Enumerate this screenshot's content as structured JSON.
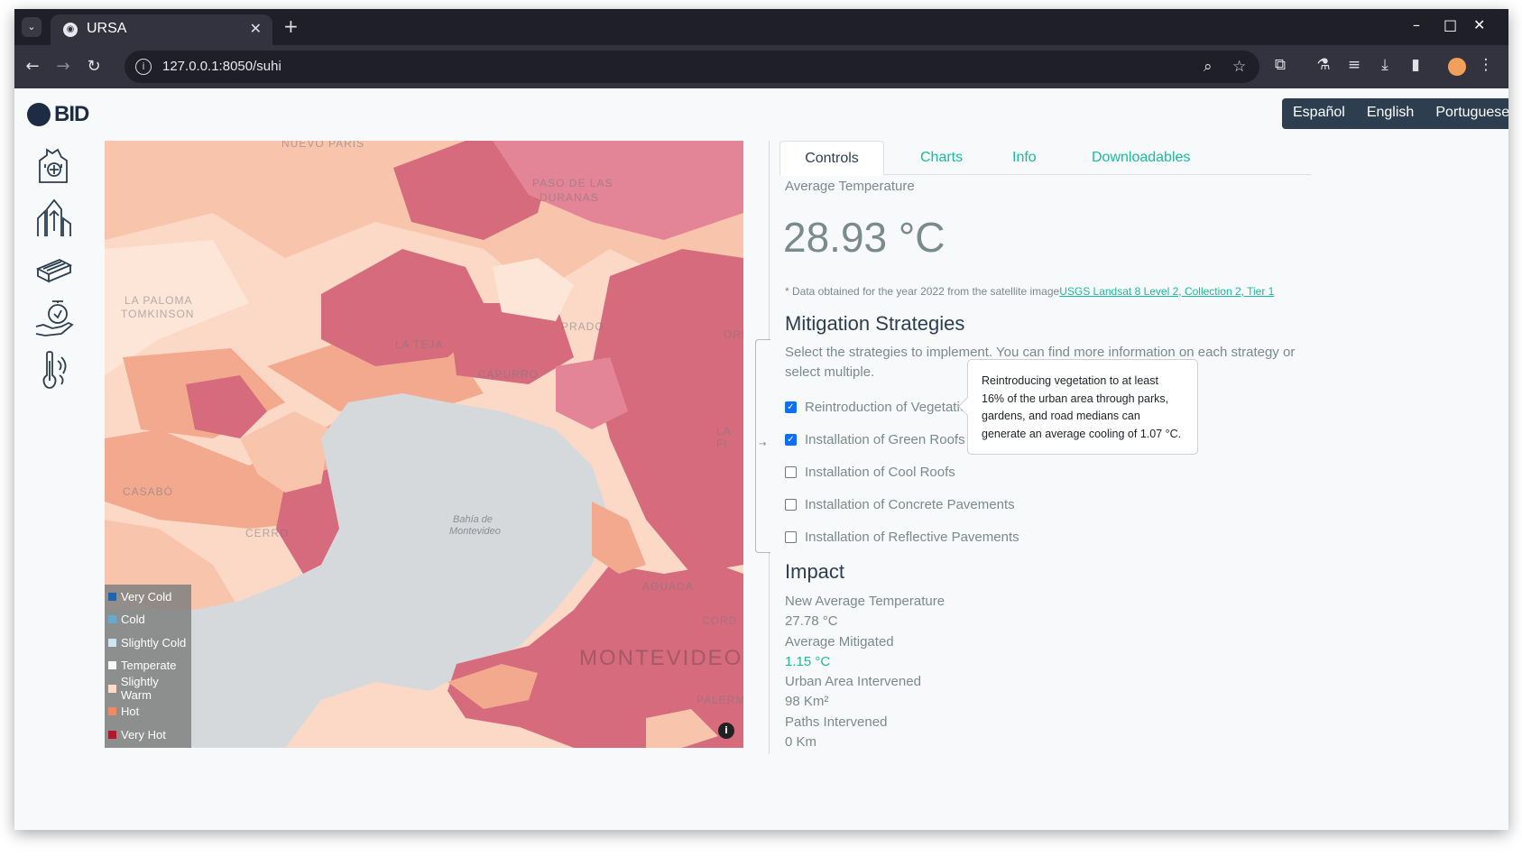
{
  "browser": {
    "tab_title": "URSA",
    "url": "127.0.0.1:8050/suhi",
    "menu_glyph": "⌄",
    "close_glyph": "✕",
    "newtab_glyph": "+",
    "minimize_glyph": "–",
    "maximize_glyph": "□",
    "window_close_glyph": "✕"
  },
  "header": {
    "logo_text": "BID",
    "languages": [
      "Español",
      "English",
      "Portuguese"
    ]
  },
  "sidenav": {
    "icons": [
      "city-growth-icon",
      "urban-expansion-icon",
      "building-blocks-icon",
      "risk-hand-icon",
      "heat-thermometer-icon"
    ]
  },
  "map": {
    "labels": [
      "NUEVO PARIS",
      "PASO DE LAS",
      "DURANAS",
      "LA PALOMA",
      "TOMKINSON",
      "PRADO",
      "LA TEJA",
      "CAPURRO",
      "CASABÓ",
      "CERRO",
      "AGUADA",
      "CORD",
      "MONTEVIDEO",
      "PALERMO",
      "LA FI",
      "ORIE"
    ],
    "water_label_1": "Bahía de",
    "water_label_2": "Montevideo",
    "info_glyph": "i",
    "legend": [
      {
        "label": "Very Cold",
        "color": "#2166ac"
      },
      {
        "label": "Cold",
        "color": "#67a9cf"
      },
      {
        "label": "Slightly Cold",
        "color": "#d1e5f0"
      },
      {
        "label": "Temperate",
        "color": "#f7f7f7"
      },
      {
        "label": "Slightly Warm",
        "color": "#fddbc7"
      },
      {
        "label": "Hot",
        "color": "#ef8a62"
      },
      {
        "label": "Very Hot",
        "color": "#b2182b"
      }
    ]
  },
  "panel": {
    "tabs": [
      "Controls",
      "Charts",
      "Info",
      "Downloadables"
    ],
    "active_tab": "Controls",
    "avg_temp_label": "Average Temperature",
    "avg_temp_value": "28.93 °C",
    "note_prefix": "* Data obtained for the year 2022 from the satellite image",
    "note_link": "USGS Landsat 8 Level 2, Collection 2, Tier 1",
    "mitigation_title": "Mitigation Strategies",
    "mitigation_desc_1": "Select the strategies to implement. You can find more information on each strategy or",
    "mitigation_desc_2": "select multiple.",
    "strategies": [
      {
        "label": "Reintroduction of Vegetation",
        "checked": true
      },
      {
        "label": "Installation of Green Roofs",
        "checked": true
      },
      {
        "label": "Installation of Cool Roofs",
        "checked": false
      },
      {
        "label": "Installation of Concrete Pavements",
        "checked": false
      },
      {
        "label": "Installation of Reflective Pavements",
        "checked": false
      }
    ],
    "tooltip": "Reintroducing vegetation to at least 16% of the urban area through parks, gardens, and road medians can generate an average cooling of 1.07 °C.",
    "impact_title": "Impact",
    "impact": {
      "new_avg_label": "New Average Temperature",
      "new_avg_value": "27.78 °C",
      "mitigated_label": "Average Mitigated",
      "mitigated_value": "1.15 °C",
      "area_label": "Urban Area Intervened",
      "area_value": "98 Km²",
      "paths_label": "Paths Intervened",
      "paths_value": "0 Km"
    }
  },
  "colors": {
    "accent": "#18bc9c",
    "primary": "#2c3e50",
    "very_hot_fill": "#d66b7d",
    "warm_fill": "#f2a98e",
    "slightly_warm_fill": "#fbd9c6"
  }
}
